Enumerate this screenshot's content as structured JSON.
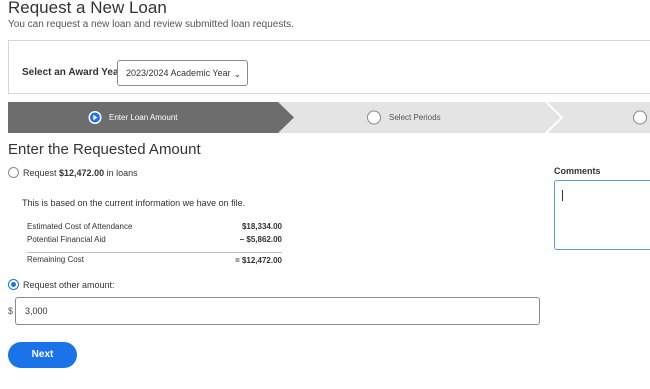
{
  "header": {
    "title": "Request a New Loan",
    "subtitle": "You can request a new loan and review submitted loan requests."
  },
  "award": {
    "label": "Select an Award Year:",
    "selected": "2023/2024 Academic Year"
  },
  "steps": [
    {
      "label": "Enter Loan Amount",
      "state": "active"
    },
    {
      "label": "Select Periods",
      "state": "pending"
    },
    {
      "label": "",
      "state": "pending"
    }
  ],
  "form": {
    "section_title": "Enter the Requested Amount",
    "option1": {
      "prefix": "Request ",
      "amount": "$12,472.00",
      "suffix": " in loans"
    },
    "info_text": "This is based on the current information we have on file.",
    "cost_rows": [
      {
        "label": "Estimated Cost of Attendance",
        "value": "$18,334.00"
      },
      {
        "label": "Potential Financial Aid",
        "value": "− $5,862.00"
      },
      {
        "label": "Remaining Cost",
        "value": "= $12,472.00"
      }
    ],
    "option2_label": "Request other amount:",
    "currency_symbol": "$",
    "amount_value": "3,000",
    "next_label": "Next"
  },
  "comments": {
    "label": "Comments"
  },
  "colors": {
    "accent": "#1a73e8",
    "step_active": "#6d6d6d",
    "step_pending": "#e4e4e4"
  }
}
